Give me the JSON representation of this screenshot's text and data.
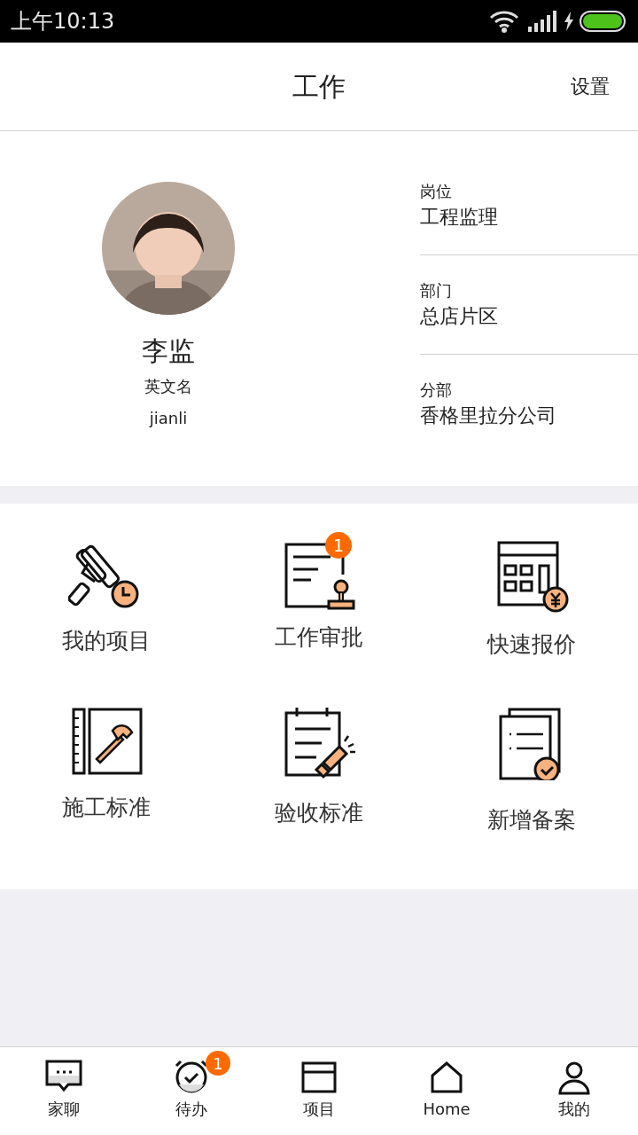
{
  "status_bar": {
    "time": "上午10:13"
  },
  "header": {
    "title": "工作",
    "action": "设置"
  },
  "profile": {
    "name": "李监",
    "english_name_label": "英文名",
    "english_name": "jianli",
    "fields": [
      {
        "label": "岗位",
        "value": "工程监理"
      },
      {
        "label": "部门",
        "value": "总店片区"
      },
      {
        "label": "分部",
        "value": "香格里拉分公司"
      }
    ]
  },
  "shortcuts": [
    {
      "kind": "roller",
      "label": "我的项目"
    },
    {
      "kind": "approval",
      "label": "工作审批",
      "badge": "1"
    },
    {
      "kind": "quote",
      "label": "快速报价"
    },
    {
      "kind": "hammer",
      "label": "施工标准"
    },
    {
      "kind": "inspect",
      "label": "验收标准"
    },
    {
      "kind": "filing",
      "label": "新增备案"
    }
  ],
  "tab_bar": [
    {
      "kind": "chat",
      "label": "家聊"
    },
    {
      "kind": "todo",
      "label": "待办",
      "badge": "1"
    },
    {
      "kind": "project",
      "label": "项目"
    },
    {
      "kind": "home",
      "label": "Home"
    },
    {
      "kind": "me",
      "label": "我的"
    }
  ]
}
